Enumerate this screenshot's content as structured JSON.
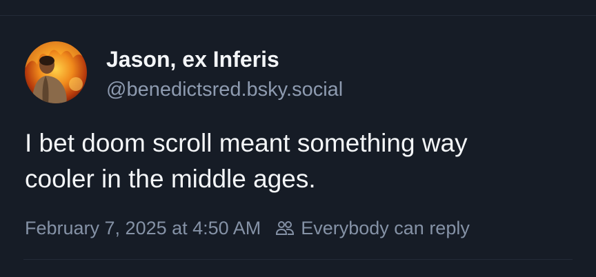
{
  "post": {
    "author": {
      "display_name": "Jason, ex Inferis",
      "handle": "@benedictsred.bsky.social"
    },
    "text_lines": [
      "I bet doom scroll meant something way",
      "cooler in the middle ages."
    ],
    "timestamp": "February 7, 2025 at 4:50 AM",
    "reply_setting_icon": "users-icon",
    "reply_setting": "Everybody can reply"
  },
  "colors": {
    "background": "#161c26",
    "primary_text": "#f3f5f7",
    "secondary_text": "#8e9bb0"
  }
}
